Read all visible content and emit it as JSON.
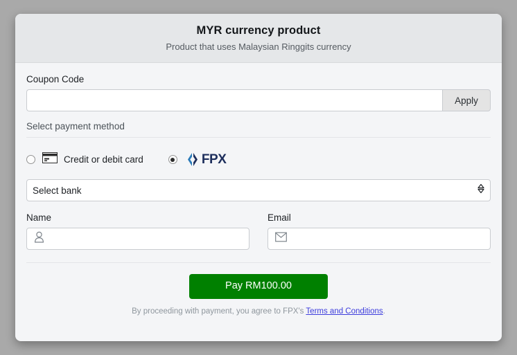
{
  "header": {
    "title": "MYR currency product",
    "subtitle": "Product that uses Malaysian Ringgits currency"
  },
  "coupon": {
    "label": "Coupon Code",
    "value": "",
    "placeholder": "",
    "apply_label": "Apply"
  },
  "payment": {
    "section_label": "Select payment method",
    "methods": [
      {
        "id": "card",
        "label": "Credit or debit card",
        "icon": "credit-card-icon",
        "selected": false
      },
      {
        "id": "fpx",
        "label": "FPX",
        "icon": "fpx-logo-icon",
        "selected": true
      }
    ]
  },
  "bank": {
    "selected_label": "Select bank",
    "options": [
      "Select bank"
    ]
  },
  "name_field": {
    "label": "Name",
    "value": "",
    "placeholder": "",
    "icon": "person-icon"
  },
  "email_field": {
    "label": "Email",
    "value": "",
    "placeholder": "",
    "icon": "envelope-icon"
  },
  "footer": {
    "pay_label": "Pay RM100.00",
    "terms_prefix": "By proceeding with payment, you agree to FPX's ",
    "terms_link": "Terms and Conditions",
    "terms_suffix": "."
  },
  "colors": {
    "pay_button": "#008000",
    "link": "#3b3bdc",
    "fpx_navy": "#1d2e5c",
    "fpx_blue": "#2a7ab8",
    "page_background": "#a9a9a9",
    "card_background": "#f4f5f7",
    "header_background": "#e5e7e9"
  }
}
